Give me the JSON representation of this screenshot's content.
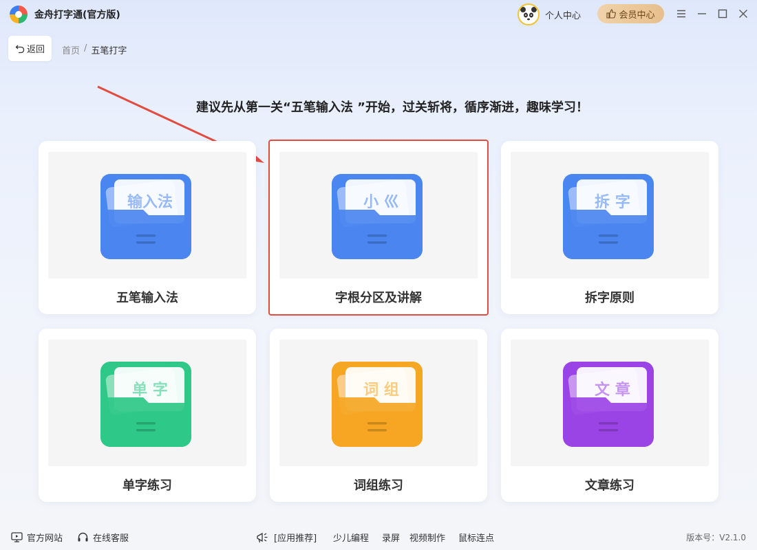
{
  "app": {
    "title": "金舟打字通(官方版)"
  },
  "header": {
    "profile_label": "个人中心",
    "vip_label": "会员中心",
    "icons": [
      "menu-icon",
      "minimize-icon",
      "maximize-icon",
      "close-icon"
    ]
  },
  "nav": {
    "back_label": "返回",
    "breadcrumb": {
      "home": "首页",
      "sep": "/",
      "current": "五笔打字"
    }
  },
  "hint": "建议先从第一关“五笔输入法 ”开始，过关斩将，循序渐进，趣味学习！",
  "cards": [
    {
      "label": "五笔输入法",
      "icon_text": "输入法",
      "color": "#4a86f0",
      "selected": false
    },
    {
      "label": "字根分区及讲解",
      "icon_text": "小 巛",
      "color": "#4a86f0",
      "selected": true
    },
    {
      "label": "拆字原则",
      "icon_text": "拆 字",
      "color": "#4a86f0",
      "selected": false
    },
    {
      "label": "单字练习",
      "icon_text": "单 字",
      "color": "#2fc888",
      "selected": false
    },
    {
      "label": "词组练习",
      "icon_text": "词 组",
      "color": "#f5a623",
      "selected": false
    },
    {
      "label": "文章练习",
      "icon_text": "文 章",
      "color": "#9b44e6",
      "selected": false
    }
  ],
  "footer": {
    "website": "官方网站",
    "support": "在线客服",
    "recommend_label": "[应用推荐]",
    "recommend_items": [
      "少儿编程",
      "录屏",
      "视频制作",
      "鼠标连点"
    ],
    "version": "版本号：V2.1.0"
  },
  "colors": {
    "accent_red": "#e24b3f",
    "vip_gold": "#e7bf8c"
  }
}
